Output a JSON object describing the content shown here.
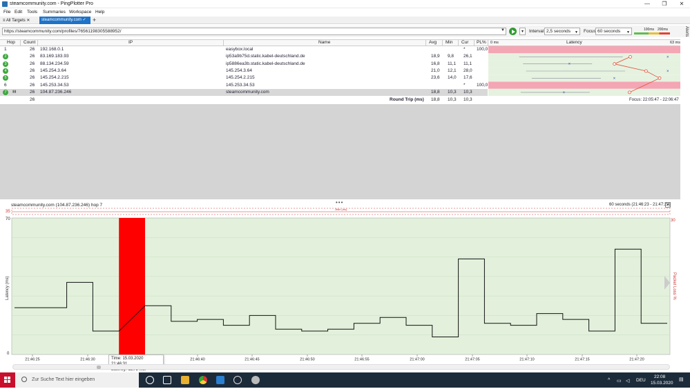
{
  "window": {
    "title": "steamcommunity.com - PingPlotter Pro",
    "minimize": "—",
    "maximize": "❐",
    "close": "✕"
  },
  "menu": [
    "File",
    "Edit",
    "Tools",
    "Summaries",
    "Workspace",
    "Help"
  ],
  "tabs": {
    "all_targets": "All Targets",
    "active": "steamcommunity.com",
    "add": "+"
  },
  "address": {
    "url": "https://steamcommunity.com/profiles/76561198305588952/",
    "interval_label": "Interval",
    "interval_value": "2,5 seconds",
    "focus_label": "Focus",
    "focus_value": "60 seconds",
    "scale_100": "100ms",
    "scale_200": "200ms",
    "alerts": "Alerts"
  },
  "table": {
    "headers": {
      "hop": "Hop",
      "count": "Count",
      "ip": "IP",
      "name": "Name",
      "avg": "Avg",
      "min": "Min",
      "cur": "Cur",
      "pl": "PL%"
    },
    "rows": [
      {
        "hop": "1",
        "count": "26",
        "ip": "192.168.0.1",
        "name": "easybox.local",
        "avg": "",
        "min": "",
        "cur": "*",
        "pl": "100,0",
        "badge": false
      },
      {
        "hop": "2",
        "count": "26",
        "ip": "83.169.183.93",
        "name": "ip53a9b75d.static.kabel-deutschland.de",
        "avg": "18,9",
        "min": "9,8",
        "cur": "26,1",
        "pl": "",
        "badge": true
      },
      {
        "hop": "3",
        "count": "26",
        "ip": "88.134.234.59",
        "name": "ip5886ea3b.static.kabel-deutschland.de",
        "avg": "16,8",
        "min": "11,1",
        "cur": "11,1",
        "pl": "",
        "badge": true
      },
      {
        "hop": "4",
        "count": "26",
        "ip": "145.254.3.64",
        "name": "145.254.3.64",
        "avg": "21,0",
        "min": "12,1",
        "cur": "28,0",
        "pl": "",
        "badge": true
      },
      {
        "hop": "5",
        "count": "26",
        "ip": "145.254.2.215",
        "name": "145.254.2.215",
        "avg": "23,6",
        "min": "14,0",
        "cur": "17,6",
        "pl": "",
        "badge": true
      },
      {
        "hop": "6",
        "count": "26",
        "ip": "145.253.34.53",
        "name": "145.253.34.53",
        "avg": "",
        "min": "",
        "cur": "*",
        "pl": "100,0",
        "badge": false
      },
      {
        "hop": "7",
        "count": "26",
        "ip": "104.87.236.246",
        "name": "steamcommunity.com",
        "avg": "18,8",
        "min": "10,3",
        "cur": "10,3",
        "pl": "",
        "badge": true
      }
    ],
    "summary": {
      "count": "26",
      "label": "Round Trip (ms)",
      "avg": "18,8",
      "min": "10,3",
      "cur": "10,3"
    },
    "latency_header": {
      "start": "0 ms",
      "title": "Latency",
      "end": "63 ms"
    },
    "focus": "Focus: 22:05:47 - 22:06:47"
  },
  "graph": {
    "title": "steamcommunity.com (104.87.236.246) hop 7",
    "range": "60 seconds (21:46:23 - 21:47:23)",
    "jitter_label": "Jitter (ms)",
    "jitter_left": "35",
    "jitter_right": "30",
    "y_label": "Latency (ms)",
    "y_right_label": "Packet Loss %",
    "y_top": "70",
    "y_bottom": "0",
    "x_ticks": [
      "21:46:25",
      "21:46:30",
      "21:46:40",
      "21:46:45",
      "21:46:50",
      "21:46:55",
      "21:47:00",
      "21:47:05",
      "21:47:10",
      "21:47:15",
      "21:47:20"
    ],
    "tooltip_time": "Time: 15.03.2020 21:46:31.",
    "tooltip_latency": "Latency: 11,72 ms."
  },
  "chart_data": {
    "type": "line",
    "title": "steamcommunity.com (104.87.236.246) hop 7",
    "ylabel": "Latency (ms)",
    "ylim": [
      0,
      70
    ],
    "step": true,
    "values": [
      24,
      24,
      37,
      12,
      70,
      25,
      17,
      18,
      15,
      20,
      13,
      12,
      13,
      16,
      19,
      15,
      9,
      49,
      16,
      15,
      21,
      18,
      12,
      54,
      16
    ],
    "lost_packet_index": 4
  },
  "taskbar": {
    "search_placeholder": "Zur Suche Text hier eingeben",
    "time": "22:08",
    "date": "15.03.2020",
    "lang": "DEU"
  }
}
